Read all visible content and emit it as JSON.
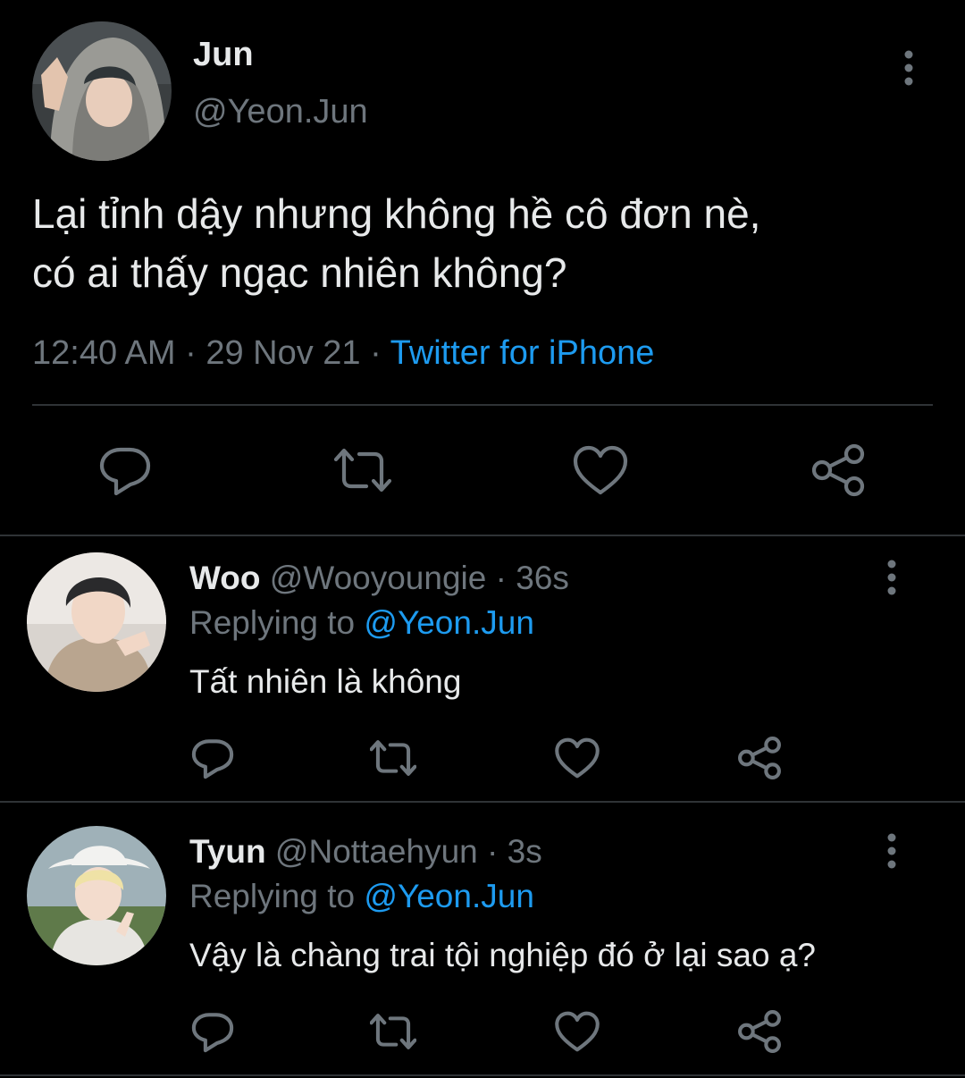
{
  "main_tweet": {
    "author_name": "Jun",
    "author_handle": "@Yeon.Jun",
    "text_line1": "Lại tỉnh dậy nhưng không hề cô đơn nè,",
    "text_line2": "có ai thấy ngạc nhiên không?",
    "time": "12:40 AM",
    "date": "29 Nov 21",
    "separator": "·",
    "source": "Twitter for iPhone",
    "actions": [
      "reply-icon",
      "retweet-icon",
      "like-icon",
      "share-icon"
    ]
  },
  "replies": [
    {
      "name": "Woo",
      "handle": "@Wooyoungie",
      "time": "36s",
      "separator": "·",
      "replying_prefix": "Replying to",
      "replying_to": "@Yeon.Jun",
      "text": "Tất nhiên là không"
    },
    {
      "name": "Tyun",
      "handle": "@Nottaehyun",
      "time": "3s",
      "separator": "·",
      "replying_prefix": "Replying to",
      "replying_to": "@Yeon.Jun",
      "text": "Vậy là chàng trai tội nghiệp đó ở lại sao ạ?"
    }
  ],
  "colors": {
    "background": "#000000",
    "primary_text": "#e7e9ea",
    "secondary_text": "#6e767d",
    "accent": "#1d9bf0",
    "divider": "#2f3336"
  }
}
